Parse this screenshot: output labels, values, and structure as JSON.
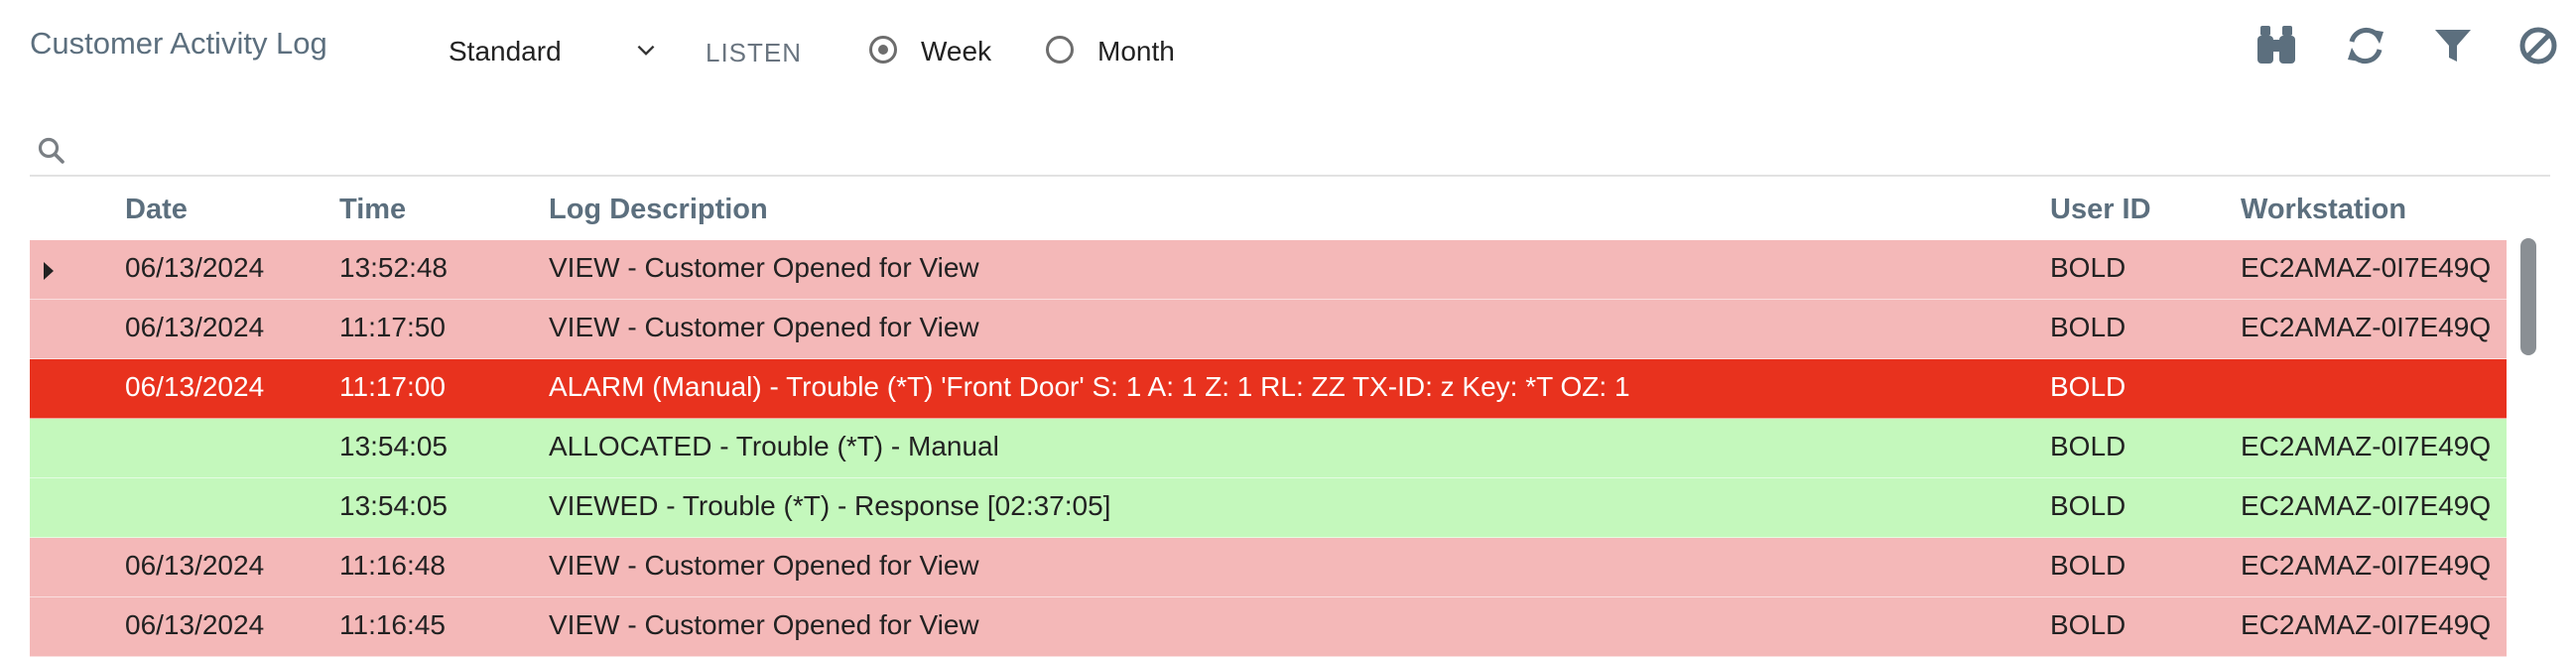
{
  "header": {
    "title": "Customer Activity Log",
    "view_select": "Standard",
    "listen_label": "LISTEN",
    "period_options": [
      {
        "label": "Week",
        "selected": true
      },
      {
        "label": "Month",
        "selected": false
      }
    ],
    "tools": [
      {
        "name": "binoculars-icon"
      },
      {
        "name": "refresh-icon"
      },
      {
        "name": "filter-icon"
      },
      {
        "name": "block-icon"
      }
    ]
  },
  "search": {
    "icon": "search-icon"
  },
  "table": {
    "columns": [
      "Date",
      "Time",
      "Log Description",
      "User ID",
      "Workstation"
    ],
    "rows": [
      {
        "date": "06/13/2024",
        "time": "13:52:48",
        "desc": "VIEW - Customer Opened for View",
        "user": "BOLD",
        "ws": "EC2AMAZ-0I7E49Q",
        "kind": "view",
        "expander": true
      },
      {
        "date": "06/13/2024",
        "time": "11:17:50",
        "desc": "VIEW - Customer Opened for View",
        "user": "BOLD",
        "ws": "EC2AMAZ-0I7E49Q",
        "kind": "view"
      },
      {
        "date": "06/13/2024",
        "time": "11:17:00",
        "desc": "ALARM (Manual) - Trouble (*T) 'Front Door' S: 1 A: 1 Z: 1 RL: ZZ TX-ID: z Key: *T OZ: 1",
        "user": "BOLD",
        "ws": "",
        "kind": "alarm"
      },
      {
        "date": "",
        "time": "13:54:05",
        "desc": "ALLOCATED - Trouble (*T) - Manual",
        "user": "BOLD",
        "ws": "EC2AMAZ-0I7E49Q",
        "kind": "action"
      },
      {
        "date": "",
        "time": "13:54:05",
        "desc": "VIEWED - Trouble (*T) - Response [02:37:05]",
        "user": "BOLD",
        "ws": "EC2AMAZ-0I7E49Q",
        "kind": "action"
      },
      {
        "date": "06/13/2024",
        "time": "11:16:48",
        "desc": "VIEW - Customer Opened for View",
        "user": "BOLD",
        "ws": "EC2AMAZ-0I7E49Q",
        "kind": "view"
      },
      {
        "date": "06/13/2024",
        "time": "11:16:45",
        "desc": "VIEW - Customer Opened for View",
        "user": "BOLD",
        "ws": "EC2AMAZ-0I7E49Q",
        "kind": "view"
      }
    ]
  },
  "colors": {
    "view": "#f4b8b8",
    "alarm": "#e8321e",
    "action": "#c4f8bc",
    "header_text": "#5c6f7e"
  }
}
